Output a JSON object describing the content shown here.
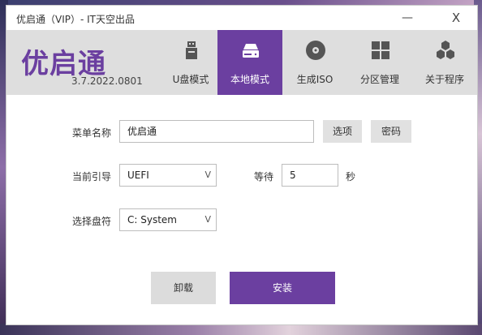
{
  "window": {
    "title": "优启通（VIP）- IT天空出品",
    "minimize_glyph": "—",
    "close_glyph": "X"
  },
  "header": {
    "logo": "优启通",
    "version": "3.7.2022.0801",
    "tabs": [
      {
        "label": "U盘模式",
        "icon": "usb-drive-icon"
      },
      {
        "label": "本地模式",
        "icon": "hard-drive-icon",
        "active": true
      },
      {
        "label": "生成ISO",
        "icon": "disc-icon"
      },
      {
        "label": "分区管理",
        "icon": "partition-grid-icon"
      },
      {
        "label": "关于程序",
        "icon": "hexagon-cluster-icon"
      }
    ],
    "accent_color": "#6b3fa0"
  },
  "form": {
    "menu_name_label": "菜单名称",
    "menu_name_value": "优启通",
    "options_button": "选项",
    "password_button": "密码",
    "boot_label": "当前引导",
    "boot_value": "UEFI",
    "wait_label": "等待",
    "wait_value": "5",
    "wait_unit": "秒",
    "drive_label": "选择盘符",
    "drive_value": "C: System",
    "chevron": "V"
  },
  "actions": {
    "uninstall": "卸载",
    "install": "安装"
  }
}
